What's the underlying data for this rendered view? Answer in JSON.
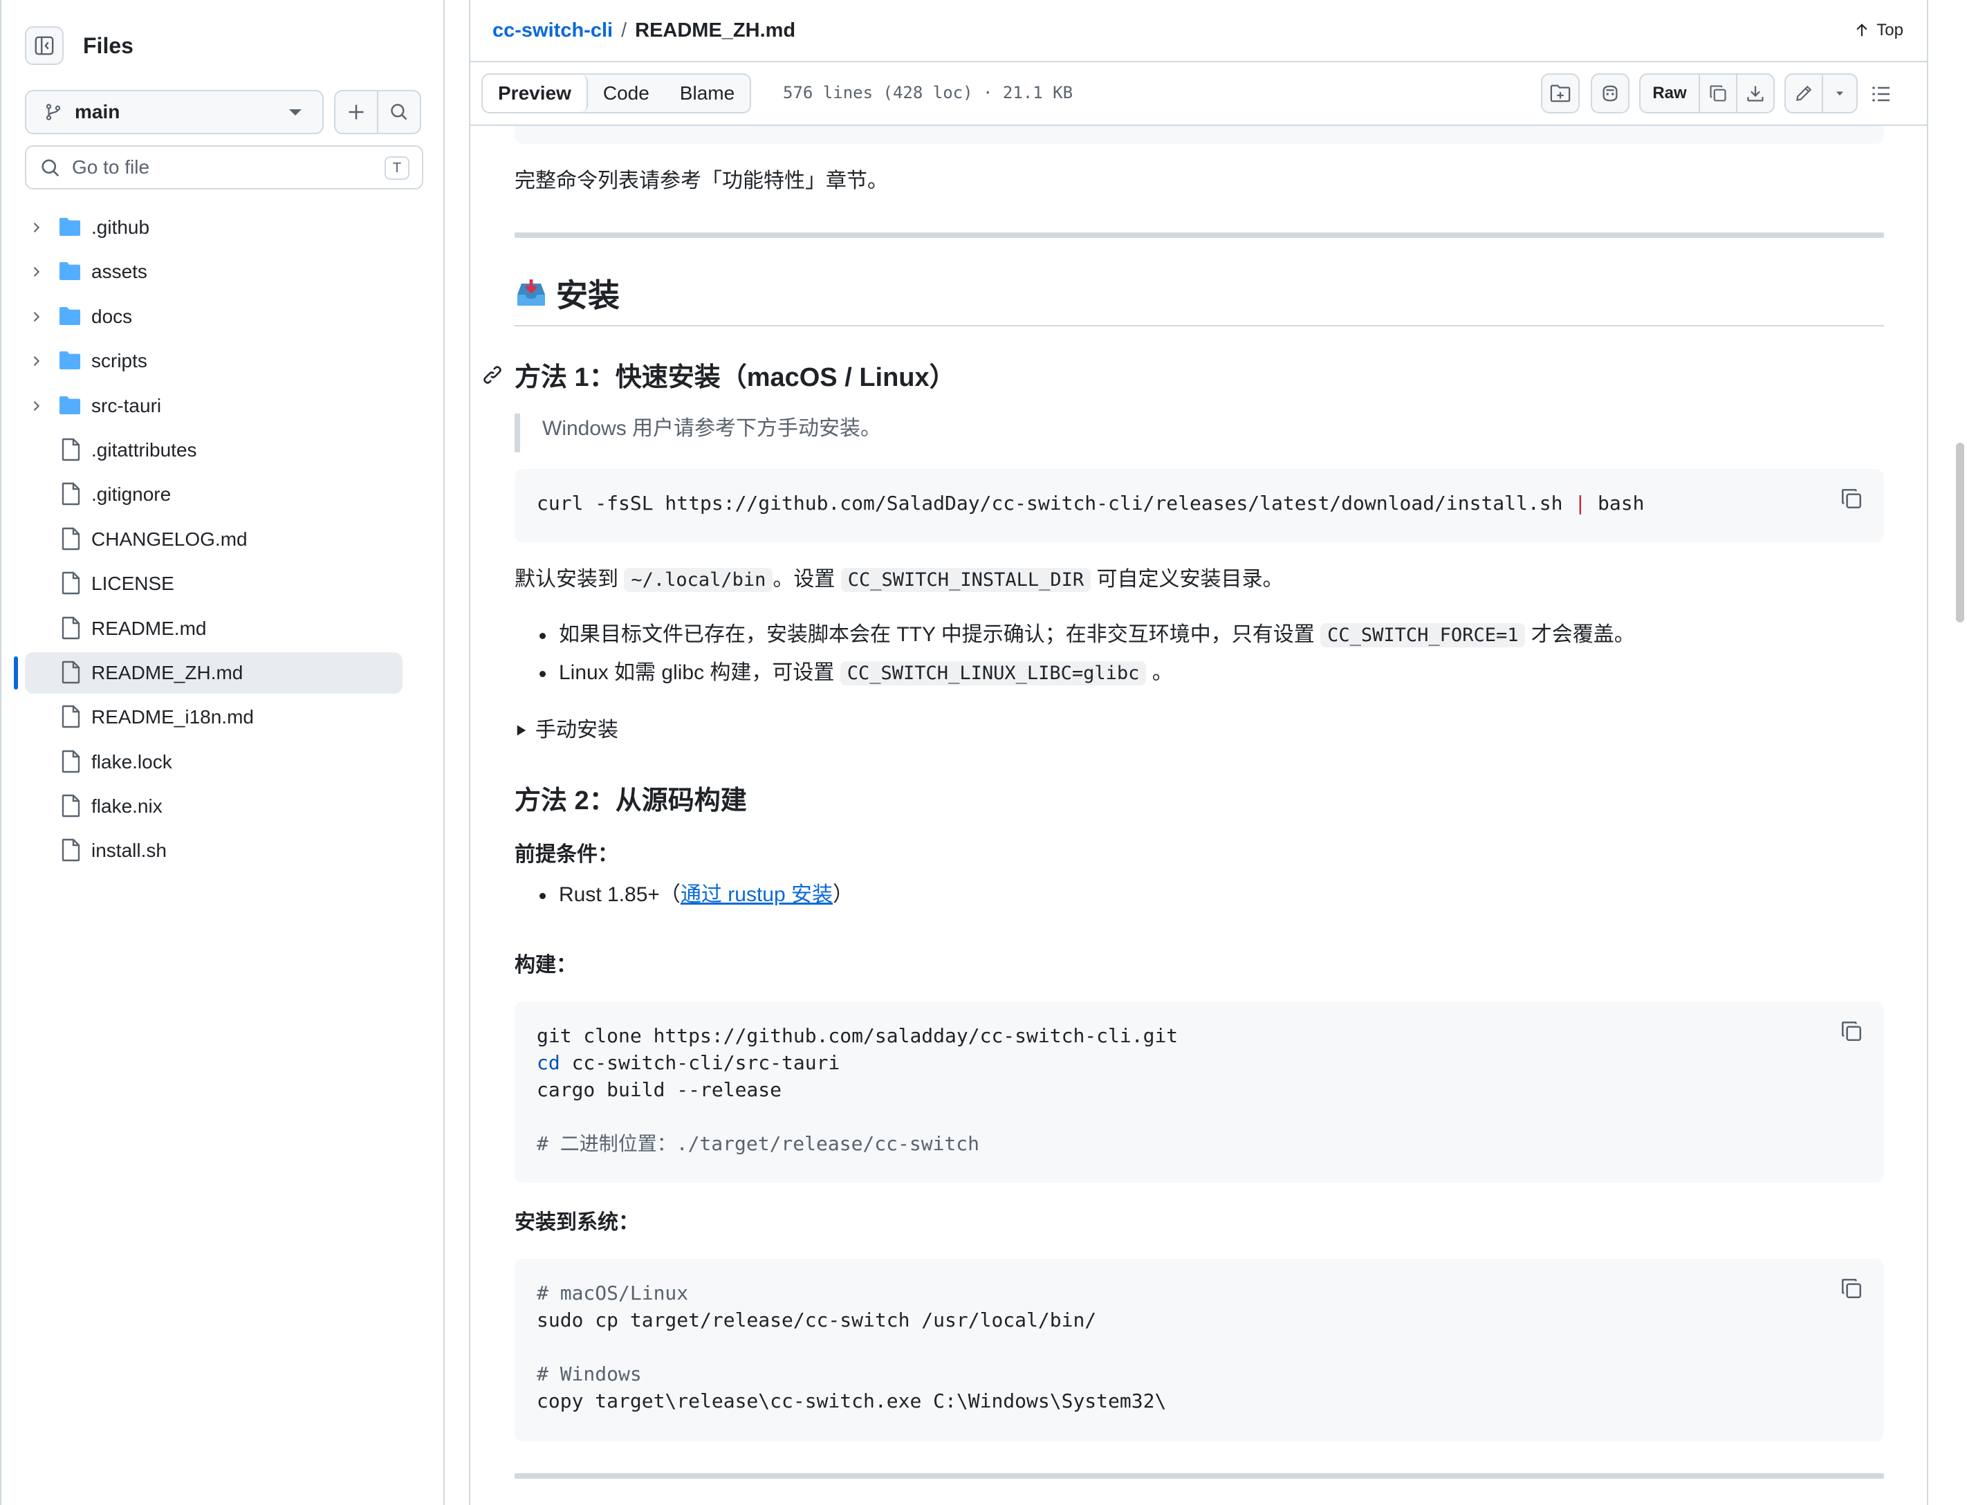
{
  "sidebar": {
    "title": "Files",
    "branch": "main",
    "goto_placeholder": "Go to file",
    "goto_kbd": "T",
    "items": [
      {
        "type": "folder",
        "label": ".github"
      },
      {
        "type": "folder",
        "label": "assets"
      },
      {
        "type": "folder",
        "label": "docs"
      },
      {
        "type": "folder",
        "label": "scripts"
      },
      {
        "type": "folder",
        "label": "src-tauri"
      },
      {
        "type": "file",
        "label": ".gitattributes"
      },
      {
        "type": "file",
        "label": ".gitignore"
      },
      {
        "type": "file",
        "label": "CHANGELOG.md"
      },
      {
        "type": "file",
        "label": "LICENSE"
      },
      {
        "type": "file",
        "label": "README.md"
      },
      {
        "type": "file",
        "label": "README_ZH.md",
        "active": true
      },
      {
        "type": "file",
        "label": "README_i18n.md"
      },
      {
        "type": "file",
        "label": "flake.lock"
      },
      {
        "type": "file",
        "label": "flake.nix"
      },
      {
        "type": "file",
        "label": "install.sh"
      }
    ]
  },
  "header": {
    "repo": "cc-switch-cli",
    "sep": "/",
    "file": "README_ZH.md",
    "top": "Top"
  },
  "toolbar": {
    "tabs": [
      "Preview",
      "Code",
      "Blame"
    ],
    "fileinfo": "576 lines (428 loc) · 21.1 KB",
    "raw": "Raw"
  },
  "content": {
    "p_intro": "完整命令列表请参考「功能特性」章节。",
    "h2_install": "安装",
    "h3_method1": "方法 1：快速安装（macOS / Linux）",
    "quote": "Windows 用户请参考下方手动安装。",
    "code1": {
      "pre": "curl -fsSL https://github.com/SaladDay/cc-switch-cli/releases/latest/download/install.sh ",
      "pipe": "|",
      "post": " bash"
    },
    "p_default": {
      "a": "默认安装到 ",
      "code_a": "~/.local/bin",
      "b": "。设置 ",
      "code_b": "CC_SWITCH_INSTALL_DIR",
      "c": " 可自定义安装目录。"
    },
    "li1": {
      "a": "如果目标文件已存在，安装脚本会在 TTY 中提示确认；在非交互环境中，只有设置 ",
      "code": "CC_SWITCH_FORCE=1",
      "b": " 才会覆盖。"
    },
    "li2": {
      "a": "Linux 如需 glibc 构建，可设置 ",
      "code": "CC_SWITCH_LINUX_LIBC=glibc",
      "b": " 。"
    },
    "details": "手动安装",
    "h3_method2": "方法 2：从源码构建",
    "prereq": "前提条件：",
    "li_rust": {
      "a": "Rust 1.85+（",
      "link": "通过 rustup 安装",
      "b": "）"
    },
    "build": "构建：",
    "code2": {
      "l1": "git clone https://github.com/saladday/cc-switch-cli.git",
      "l2_kw": "cd",
      "l2": " cc-switch-cli/src-tauri",
      "l3": "cargo build --release",
      "l5": "# 二进制位置：./target/release/cc-switch"
    },
    "install_sys": "安装到系统：",
    "code3": {
      "l1": "# macOS/Linux",
      "l2": "sudo cp target/release/cc-switch /usr/local/bin/",
      "l4": "# Windows",
      "l5": "copy target\\release\\cc-switch.exe C:\\Windows\\System32\\"
    }
  },
  "colors": {
    "accent": "#0969da",
    "border": "#d1d9e0",
    "code_bg": "#f6f8fa"
  }
}
